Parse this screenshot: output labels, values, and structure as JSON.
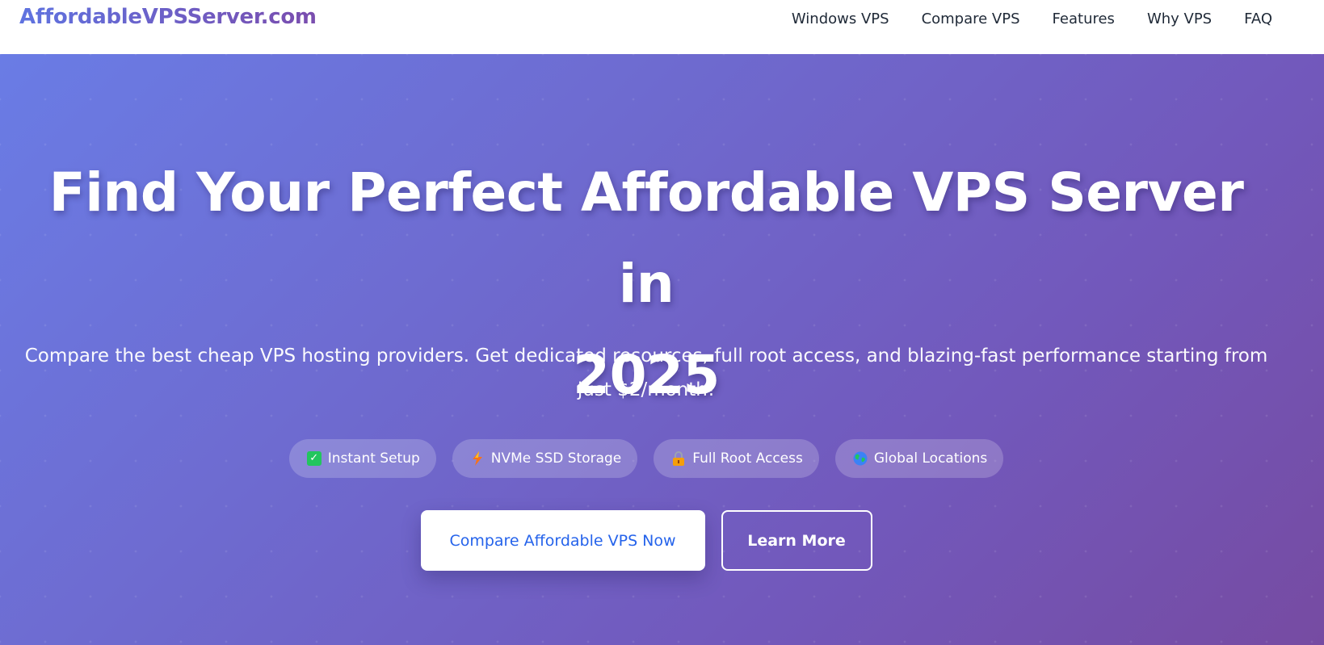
{
  "header": {
    "logo_text": "AffordableVPSServer.com",
    "nav": [
      {
        "label": "Windows VPS"
      },
      {
        "label": "Compare VPS"
      },
      {
        "label": "Features"
      },
      {
        "label": "Why VPS"
      },
      {
        "label": "FAQ"
      }
    ]
  },
  "hero": {
    "title_line1": "Find Your Perfect Affordable VPS Server in",
    "title_line2": "2025",
    "subtitle_line1": "Compare the best cheap VPS hosting providers. Get dedicated resources, full root access, and blazing-fast performance starting from",
    "subtitle_line2": "just $2/month!",
    "badges": [
      {
        "icon": "check-icon",
        "label": "Instant Setup"
      },
      {
        "icon": "lightning-icon",
        "label": "NVMe SSD Storage"
      },
      {
        "icon": "lock-icon",
        "label": "Full Root Access"
      },
      {
        "icon": "globe-icon",
        "label": "Global Locations"
      }
    ],
    "primary_button": "Compare Affordable VPS Now",
    "secondary_button": "Learn More"
  },
  "colors": {
    "gradient_start": "#667eea",
    "gradient_end": "#764ba2",
    "primary_button_text": "#2563eb",
    "nav_text": "#1f2937"
  }
}
